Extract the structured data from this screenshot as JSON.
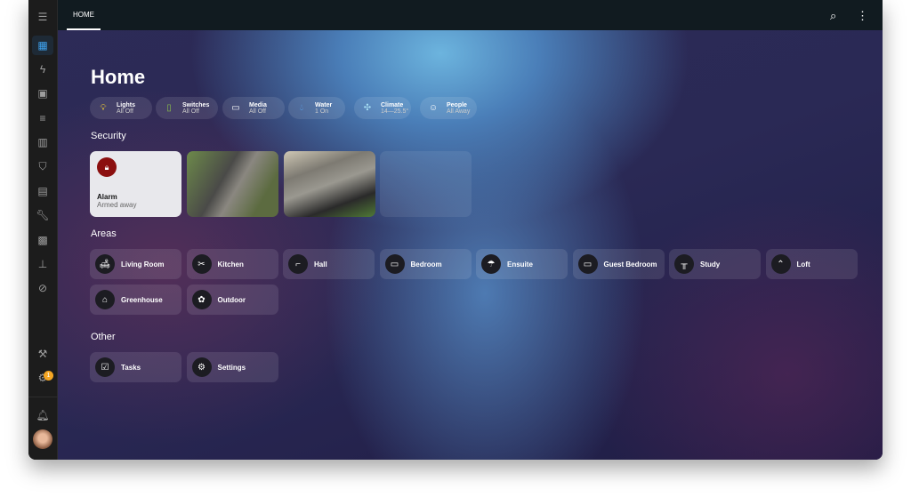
{
  "header": {
    "tab": "HOME"
  },
  "page": {
    "title": "Home"
  },
  "chips": [
    {
      "label": "Lights",
      "state": "All Off",
      "icon": "bulb-icon",
      "color": "#f6d233"
    },
    {
      "label": "Switches",
      "state": "All Off",
      "icon": "switch-icon",
      "color": "#8bc34a"
    },
    {
      "label": "Media",
      "state": "All Off",
      "icon": "media-icon",
      "color": "#ffffff"
    },
    {
      "label": "Water",
      "state": "1 On",
      "icon": "water-drop-icon",
      "color": "#5aa8ef"
    },
    {
      "label": "Climate",
      "state": "14—25.5°",
      "icon": "fan-icon",
      "color": "#a8e0f5"
    },
    {
      "label": "People",
      "state": "All Away",
      "icon": "face-icon",
      "color": "#ffffff"
    }
  ],
  "sections": {
    "security": "Security",
    "areas": "Areas",
    "other": "Other"
  },
  "alarm": {
    "name": "Alarm",
    "state": "Armed away",
    "color": "#8b0f0f"
  },
  "areas": [
    "Living Room",
    "Kitchen",
    "Hall",
    "Bedroom",
    "Ensuite",
    "Guest Bedroom",
    "Study",
    "Loft",
    "Greenhouse",
    "Outdoor"
  ],
  "other": [
    "Tasks",
    "Settings"
  ],
  "sidebar": {
    "badge": "1"
  }
}
